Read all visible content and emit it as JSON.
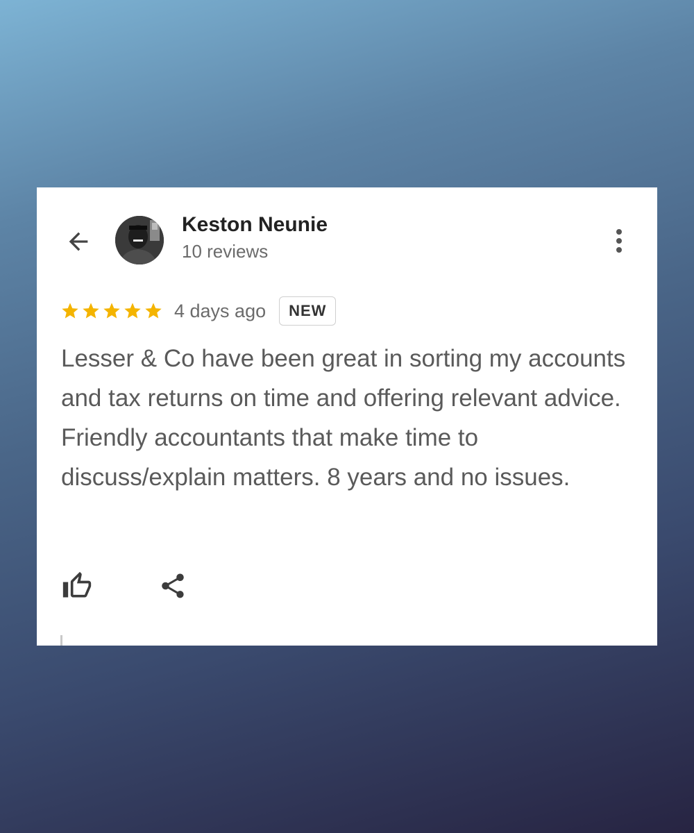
{
  "reviewer": {
    "name": "Keston Neunie",
    "reviews_count": "10 reviews"
  },
  "review": {
    "rating": 5,
    "max_rating": 5,
    "star_color": "#f4b400",
    "time_ago": "4 days ago",
    "badge": "NEW",
    "text": "Lesser & Co have been great in sorting my accounts and tax returns on time and offering relevant advice. Friendly accountants that make time to discuss/explain matters. 8 years and no issues."
  },
  "icons": {
    "back": "arrow-back-icon",
    "more": "more-vertical-icon",
    "like": "thumbs-up-icon",
    "share": "share-icon"
  },
  "colors": {
    "card_background": "#ffffff",
    "name_text": "#222222",
    "body_text": "#5a5a5a",
    "secondary_text": "#6b6b6b"
  }
}
